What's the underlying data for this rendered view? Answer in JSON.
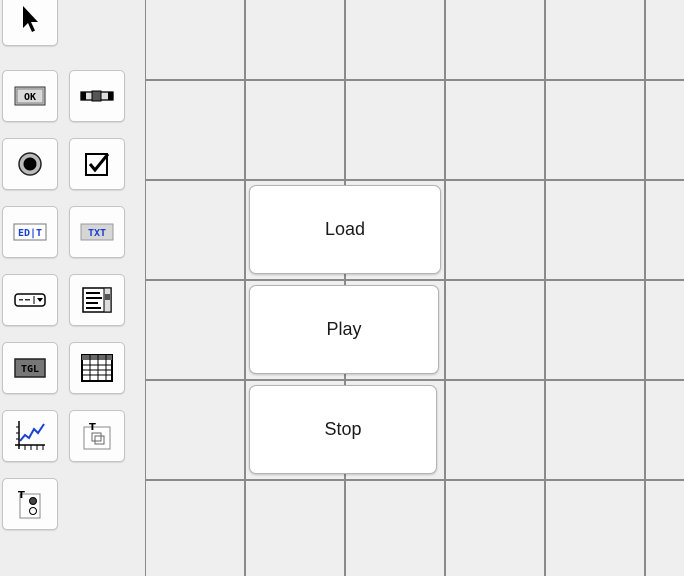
{
  "palette": {
    "tools": [
      {
        "icon": "pointer-arrow-icon"
      },
      {
        "icon": "ok-button-icon",
        "label": "OK"
      },
      {
        "icon": "slider-icon"
      },
      {
        "icon": "radio-button-icon"
      },
      {
        "icon": "checkbox-icon"
      },
      {
        "icon": "edit-field-icon",
        "label": "ED|T"
      },
      {
        "icon": "text-label-icon",
        "label": "TXT"
      },
      {
        "icon": "dropdown-menu-icon"
      },
      {
        "icon": "list-box-icon"
      },
      {
        "icon": "toggle-button-icon",
        "label": "TGL"
      },
      {
        "icon": "table-grid-icon"
      },
      {
        "icon": "graph-plot-icon"
      },
      {
        "icon": "tab-group-icon"
      },
      {
        "icon": "radio-group-icon"
      }
    ]
  },
  "canvas": {
    "buttons": [
      {
        "label": "Load"
      },
      {
        "label": "Play"
      },
      {
        "label": "Stop"
      }
    ]
  }
}
